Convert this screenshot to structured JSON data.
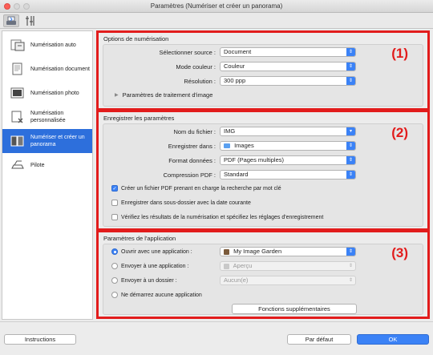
{
  "window": {
    "title": "Paramètres (Numériser et créer un panorama)"
  },
  "toolbar": {
    "tab1_icon": "scan-settings-icon",
    "tab2_icon": "general-settings-icon"
  },
  "sidebar": {
    "items": [
      {
        "label": "Numérisation auto",
        "icon": "auto-scan-icon"
      },
      {
        "label": "Numérisation document",
        "icon": "document-scan-icon"
      },
      {
        "label": "Numérisation photo",
        "icon": "photo-scan-icon"
      },
      {
        "label": "Numérisation personnalisée",
        "icon": "custom-scan-icon"
      },
      {
        "label": "Numériser et créer un panorama",
        "icon": "panorama-scan-icon",
        "selected": true
      },
      {
        "label": "Pilote",
        "icon": "driver-icon"
      }
    ]
  },
  "scan_options": {
    "title": "Options de numérisation",
    "badge": "(1)",
    "source_label": "Sélectionner source :",
    "source_value": "Document",
    "color_label": "Mode couleur :",
    "color_value": "Couleur",
    "resolution_label": "Résolution :",
    "resolution_value": "300 ppp",
    "image_processing_label": "Paramètres de traitement d'image"
  },
  "save_settings": {
    "title": "Enregistrer les paramètres",
    "badge": "(2)",
    "filename_label": "Nom du fichier :",
    "filename_value": "IMG",
    "save_in_label": "Enregistrer dans :",
    "save_in_value": "Images",
    "format_label": "Format données :",
    "format_value": "PDF (Pages multiples)",
    "compression_label": "Compression PDF :",
    "compression_value": "Standard",
    "check1_label": "Créer un fichier PDF prenant en charge la recherche par mot clé",
    "check1_checked": true,
    "check2_label": "Enregistrer dans sous-dossier avec la date courante",
    "check2_checked": false,
    "check3_label": "Vérifiez les résultats de la numérisation et spécifiez les réglages d'enregistrement",
    "check3_checked": false
  },
  "app_settings": {
    "title": "Paramètres de l'application",
    "badge": "(3)",
    "radio1_label": "Ouvrir avec une application :",
    "radio1_value": "My Image Garden",
    "radio2_label": "Envoyer à une application :",
    "radio2_value": "Aperçu",
    "radio3_label": "Envoyer à un dossier :",
    "radio3_value": "Aucun(e)",
    "radio4_label": "Ne démarrez aucune application",
    "more_functions_label": "Fonctions supplémentaires"
  },
  "footer": {
    "instructions_label": "Instructions",
    "default_label": "Par défaut",
    "ok_label": "OK"
  },
  "colors": {
    "accent": "#3b82f6",
    "highlight": "#e21c1c",
    "selected": "#2d6fdc"
  }
}
